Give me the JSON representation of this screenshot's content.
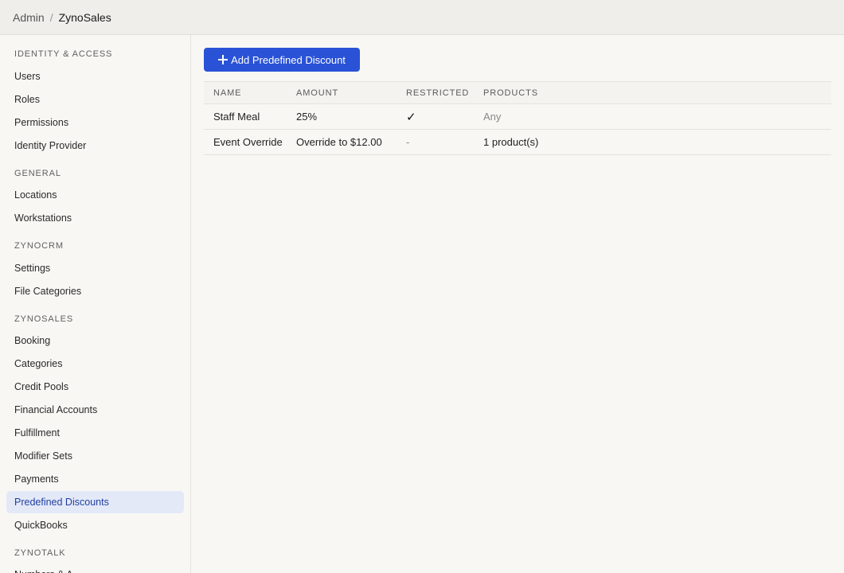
{
  "breadcrumb": {
    "root": "Admin",
    "separator": "/",
    "current": "ZynoSales"
  },
  "sidebar": {
    "sections": [
      {
        "heading": "IDENTITY & ACCESS",
        "items": [
          "Users",
          "Roles",
          "Permissions",
          "Identity Provider"
        ]
      },
      {
        "heading": "GENERAL",
        "items": [
          "Locations",
          "Workstations"
        ]
      },
      {
        "heading": "ZYNOCRM",
        "items": [
          "Settings",
          "File Categories"
        ]
      },
      {
        "heading": "ZYNOSALES",
        "items": [
          "Booking",
          "Categories",
          "Credit Pools",
          "Financial Accounts",
          "Fulfillment",
          "Modifier Sets",
          "Payments",
          "Predefined Discounts",
          "QuickBooks"
        ]
      },
      {
        "heading": "ZYNOTALK",
        "items": [
          "Numbers & A..."
        ]
      }
    ],
    "active_item": "Predefined Discounts"
  },
  "main": {
    "add_button_label": "Add Predefined Discount",
    "table": {
      "columns": [
        "NAME",
        "AMOUNT",
        "RESTRICTED",
        "PRODUCTS"
      ],
      "rows": [
        {
          "name": "Staff Meal",
          "amount": "25%",
          "restricted": "✓",
          "products": "Any"
        },
        {
          "name": "Event Override",
          "amount": "Override to $12.00",
          "restricted": "-",
          "products": "1 product(s)"
        }
      ]
    }
  },
  "colors": {
    "accent": "#2a52d6",
    "active_bg": "#e4e9f8",
    "active_text": "#1f3f9f"
  }
}
